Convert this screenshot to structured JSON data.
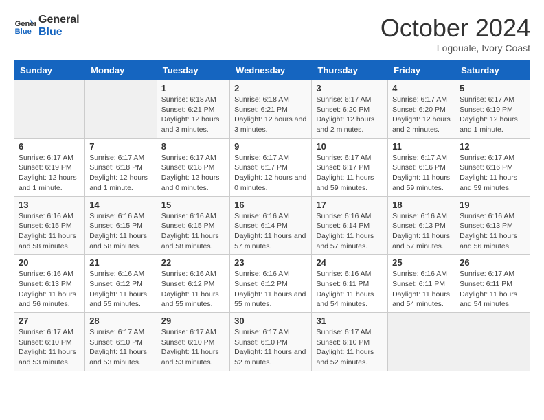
{
  "logo": {
    "line1": "General",
    "line2": "Blue"
  },
  "title": "October 2024",
  "subtitle": "Logouale, Ivory Coast",
  "days_of_week": [
    "Sunday",
    "Monday",
    "Tuesday",
    "Wednesday",
    "Thursday",
    "Friday",
    "Saturday"
  ],
  "weeks": [
    [
      {
        "day": "",
        "info": ""
      },
      {
        "day": "",
        "info": ""
      },
      {
        "day": "1",
        "info": "Sunrise: 6:18 AM\nSunset: 6:21 PM\nDaylight: 12 hours and 3 minutes."
      },
      {
        "day": "2",
        "info": "Sunrise: 6:18 AM\nSunset: 6:21 PM\nDaylight: 12 hours and 3 minutes."
      },
      {
        "day": "3",
        "info": "Sunrise: 6:17 AM\nSunset: 6:20 PM\nDaylight: 12 hours and 2 minutes."
      },
      {
        "day": "4",
        "info": "Sunrise: 6:17 AM\nSunset: 6:20 PM\nDaylight: 12 hours and 2 minutes."
      },
      {
        "day": "5",
        "info": "Sunrise: 6:17 AM\nSunset: 6:19 PM\nDaylight: 12 hours and 1 minute."
      }
    ],
    [
      {
        "day": "6",
        "info": "Sunrise: 6:17 AM\nSunset: 6:19 PM\nDaylight: 12 hours and 1 minute."
      },
      {
        "day": "7",
        "info": "Sunrise: 6:17 AM\nSunset: 6:18 PM\nDaylight: 12 hours and 1 minute."
      },
      {
        "day": "8",
        "info": "Sunrise: 6:17 AM\nSunset: 6:18 PM\nDaylight: 12 hours and 0 minutes."
      },
      {
        "day": "9",
        "info": "Sunrise: 6:17 AM\nSunset: 6:17 PM\nDaylight: 12 hours and 0 minutes."
      },
      {
        "day": "10",
        "info": "Sunrise: 6:17 AM\nSunset: 6:17 PM\nDaylight: 11 hours and 59 minutes."
      },
      {
        "day": "11",
        "info": "Sunrise: 6:17 AM\nSunset: 6:16 PM\nDaylight: 11 hours and 59 minutes."
      },
      {
        "day": "12",
        "info": "Sunrise: 6:17 AM\nSunset: 6:16 PM\nDaylight: 11 hours and 59 minutes."
      }
    ],
    [
      {
        "day": "13",
        "info": "Sunrise: 6:16 AM\nSunset: 6:15 PM\nDaylight: 11 hours and 58 minutes."
      },
      {
        "day": "14",
        "info": "Sunrise: 6:16 AM\nSunset: 6:15 PM\nDaylight: 11 hours and 58 minutes."
      },
      {
        "day": "15",
        "info": "Sunrise: 6:16 AM\nSunset: 6:15 PM\nDaylight: 11 hours and 58 minutes."
      },
      {
        "day": "16",
        "info": "Sunrise: 6:16 AM\nSunset: 6:14 PM\nDaylight: 11 hours and 57 minutes."
      },
      {
        "day": "17",
        "info": "Sunrise: 6:16 AM\nSunset: 6:14 PM\nDaylight: 11 hours and 57 minutes."
      },
      {
        "day": "18",
        "info": "Sunrise: 6:16 AM\nSunset: 6:13 PM\nDaylight: 11 hours and 57 minutes."
      },
      {
        "day": "19",
        "info": "Sunrise: 6:16 AM\nSunset: 6:13 PM\nDaylight: 11 hours and 56 minutes."
      }
    ],
    [
      {
        "day": "20",
        "info": "Sunrise: 6:16 AM\nSunset: 6:13 PM\nDaylight: 11 hours and 56 minutes."
      },
      {
        "day": "21",
        "info": "Sunrise: 6:16 AM\nSunset: 6:12 PM\nDaylight: 11 hours and 55 minutes."
      },
      {
        "day": "22",
        "info": "Sunrise: 6:16 AM\nSunset: 6:12 PM\nDaylight: 11 hours and 55 minutes."
      },
      {
        "day": "23",
        "info": "Sunrise: 6:16 AM\nSunset: 6:12 PM\nDaylight: 11 hours and 55 minutes."
      },
      {
        "day": "24",
        "info": "Sunrise: 6:16 AM\nSunset: 6:11 PM\nDaylight: 11 hours and 54 minutes."
      },
      {
        "day": "25",
        "info": "Sunrise: 6:16 AM\nSunset: 6:11 PM\nDaylight: 11 hours and 54 minutes."
      },
      {
        "day": "26",
        "info": "Sunrise: 6:17 AM\nSunset: 6:11 PM\nDaylight: 11 hours and 54 minutes."
      }
    ],
    [
      {
        "day": "27",
        "info": "Sunrise: 6:17 AM\nSunset: 6:10 PM\nDaylight: 11 hours and 53 minutes."
      },
      {
        "day": "28",
        "info": "Sunrise: 6:17 AM\nSunset: 6:10 PM\nDaylight: 11 hours and 53 minutes."
      },
      {
        "day": "29",
        "info": "Sunrise: 6:17 AM\nSunset: 6:10 PM\nDaylight: 11 hours and 53 minutes."
      },
      {
        "day": "30",
        "info": "Sunrise: 6:17 AM\nSunset: 6:10 PM\nDaylight: 11 hours and 52 minutes."
      },
      {
        "day": "31",
        "info": "Sunrise: 6:17 AM\nSunset: 6:10 PM\nDaylight: 11 hours and 52 minutes."
      },
      {
        "day": "",
        "info": ""
      },
      {
        "day": "",
        "info": ""
      }
    ]
  ]
}
